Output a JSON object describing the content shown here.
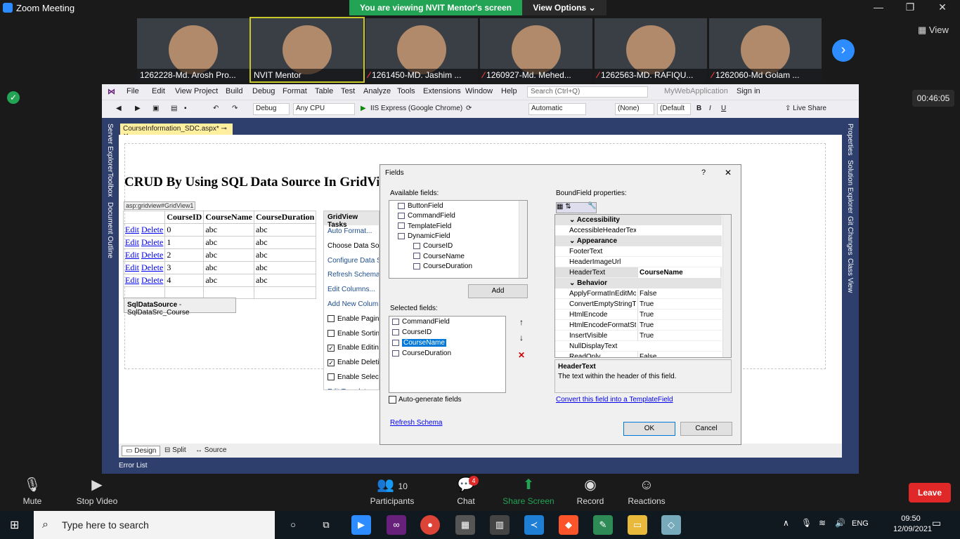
{
  "zoom": {
    "window_title": "Zoom Meeting",
    "banner": "You are viewing NVIT Mentor's screen",
    "view_options": "View Options",
    "view_label": "View",
    "timer": "00:46:05",
    "participants": [
      {
        "name": "1262228-Md. Arosh Pro...",
        "muted": false
      },
      {
        "name": "NVIT Mentor",
        "muted": false
      },
      {
        "name": "1261450-MD. Jashim ...",
        "muted": true
      },
      {
        "name": "1260927-Md. Mehed...",
        "muted": true
      },
      {
        "name": "1262563-MD. RAFIQU...",
        "muted": true
      },
      {
        "name": "1262060-Md Golam ...",
        "muted": true
      }
    ],
    "toolbar": {
      "mute": "Mute",
      "stop_video": "Stop Video",
      "participants": "Participants",
      "participants_count": "10",
      "chat": "Chat",
      "chat_badge": "4",
      "share_screen": "Share Screen",
      "record": "Record",
      "reactions": "Reactions",
      "leave": "Leave"
    }
  },
  "vs": {
    "menu": [
      "File",
      "Edit",
      "View",
      "Project",
      "Build",
      "Debug",
      "Format",
      "Table",
      "Test",
      "Analyze",
      "Tools",
      "Extensions",
      "Window",
      "Help"
    ],
    "search_placeholder": "Search (Ctrl+Q)",
    "app_name": "MyWebApplication",
    "sign_in": "Sign in",
    "config": "Debug",
    "platform": "Any CPU",
    "run_target": "IIS Express (Google Chrome)",
    "position": "Automatic",
    "style": "(None)",
    "font": "(Default",
    "live_share": "Live Share",
    "left_rail": [
      "Server Explorer",
      "Toolbox",
      "Document Outline"
    ],
    "right_rail": [
      "Properties",
      "Solution Explorer",
      "Git Changes",
      "Class View"
    ],
    "doc_tab": "CourseInformation_SDC.aspx*",
    "page_heading": "CRUD By Using SQL Data Source In GridView",
    "gv_label": "asp:gridview#GridView1",
    "grid_headers": [
      "",
      "CourseID",
      "CourseName",
      "CourseDuration"
    ],
    "grid_rows": [
      {
        "edit": "Edit",
        "del": "Delete",
        "id": "0",
        "name": "abc",
        "dur": "abc"
      },
      {
        "edit": "Edit",
        "del": "Delete",
        "id": "1",
        "name": "abc",
        "dur": "abc"
      },
      {
        "edit": "Edit",
        "del": "Delete",
        "id": "2",
        "name": "abc",
        "dur": "abc"
      },
      {
        "edit": "Edit",
        "del": "Delete",
        "id": "3",
        "name": "abc",
        "dur": "abc"
      },
      {
        "edit": "Edit",
        "del": "Delete",
        "id": "4",
        "name": "abc",
        "dur": "abc"
      }
    ],
    "sqlds_type": "SqlDataSource",
    "sqlds_name": " - SqlDataSrc_Course",
    "gv_tasks_title": "GridView Tasks",
    "gv_tasks": [
      {
        "label": "Auto Format...",
        "kind": "link"
      },
      {
        "label": "Choose Data Sour",
        "kind": "text"
      },
      {
        "label": "Configure Data So",
        "kind": "link"
      },
      {
        "label": "Refresh Schema",
        "kind": "link"
      },
      {
        "label": "Edit Columns...",
        "kind": "link"
      },
      {
        "label": "Add New Column",
        "kind": "link"
      },
      {
        "label": "Enable Paging",
        "kind": "check",
        "checked": false
      },
      {
        "label": "Enable Sorting",
        "kind": "check",
        "checked": false
      },
      {
        "label": "Enable Editing",
        "kind": "check",
        "checked": true
      },
      {
        "label": "Enable Deleting",
        "kind": "check",
        "checked": true
      },
      {
        "label": "Enable Selection",
        "kind": "check",
        "checked": false
      },
      {
        "label": "Edit Templates",
        "kind": "link"
      }
    ],
    "view_tabs": [
      "Design",
      "Split",
      "Source"
    ],
    "error_list": "Error List"
  },
  "dialog": {
    "title": "Fields",
    "available_label": "Available fields:",
    "available": [
      "ButtonField",
      "CommandField",
      "TemplateField",
      "DynamicField",
      "CourseID",
      "CourseName",
      "CourseDuration"
    ],
    "add": "Add",
    "selected_label": "Selected fields:",
    "selected": [
      "CommandField",
      "CourseID",
      "CourseName",
      "CourseDuration"
    ],
    "selected_index": 2,
    "autogen": "Auto-generate fields",
    "refresh": "Refresh Schema",
    "props_label": "BoundField properties:",
    "categories": [
      {
        "name": "Accessibility",
        "rows": [
          {
            "k": "AccessibleHeaderText",
            "v": ""
          }
        ]
      },
      {
        "name": "Appearance",
        "rows": [
          {
            "k": "FooterText",
            "v": ""
          },
          {
            "k": "HeaderImageUrl",
            "v": ""
          },
          {
            "k": "HeaderText",
            "v": "CourseName"
          }
        ]
      },
      {
        "name": "Behavior",
        "rows": [
          {
            "k": "ApplyFormatInEditMo",
            "v": "False"
          },
          {
            "k": "ConvertEmptyStringTo",
            "v": "True"
          },
          {
            "k": "HtmlEncode",
            "v": "True"
          },
          {
            "k": "HtmlEncodeFormatStr",
            "v": "True"
          },
          {
            "k": "InsertVisible",
            "v": "True"
          },
          {
            "k": "NullDisplayText",
            "v": ""
          },
          {
            "k": "ReadOnly",
            "v": "False"
          }
        ]
      }
    ],
    "desc_title": "HeaderText",
    "desc_text": "The text within the header of this field.",
    "convert": "Convert this field into a TemplateField",
    "ok": "OK",
    "cancel": "Cancel"
  },
  "taskbar": {
    "search": "Type here to search",
    "lang": "ENG",
    "time": "09:50",
    "date": "12/09/2021"
  }
}
